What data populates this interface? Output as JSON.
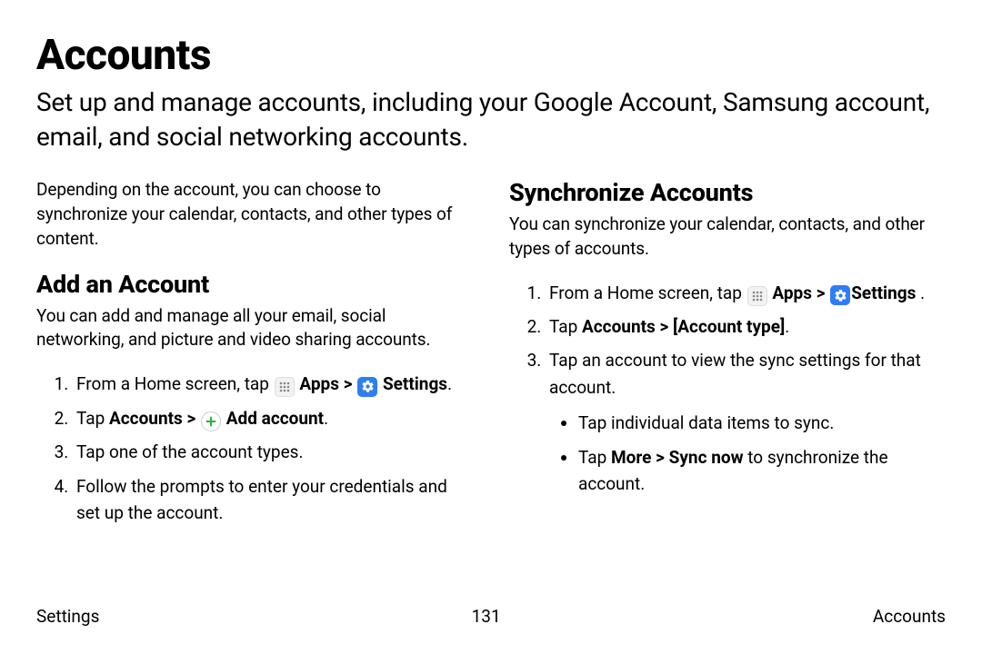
{
  "page": {
    "title": "Accounts",
    "intro": "Set up and manage accounts, including your Google Account, Samsung account, email, and social networking accounts."
  },
  "left": {
    "preface": "Depending on the account, you can choose to synchronize your calendar, contacts, and other types of content.",
    "heading": "Add an Account",
    "desc": "You can add and manage all your email, social networking, and picture and video sharing accounts.",
    "step1_pre": "From a Home screen, tap ",
    "apps_label": "Apps",
    "chev": ">",
    "settings_label": "Settings",
    "step1_post": ".",
    "step2_pre": "Tap ",
    "step2_accounts": "Accounts",
    "step2_chev": " > ",
    "step2_addaccount": "Add account",
    "step2_post": ".",
    "step3": "Tap one of the account types.",
    "step4": "Follow the prompts to enter your credentials and set up the account."
  },
  "right": {
    "heading": "Synchronize Accounts",
    "desc": "You can synchronize your calendar, contacts, and other types of accounts.",
    "step1_pre": "From a Home screen, tap ",
    "apps_label": "Apps",
    "chev": " > ",
    "settings_label": "Settings",
    "step1_post": " .",
    "step2_pre": "Tap ",
    "step2_bold": "Accounts > [Account type]",
    "step2_post": ".",
    "step3": "Tap an account to view the sync settings for that account.",
    "bullet1": "Tap individual data items to sync.",
    "bullet2_pre": "Tap ",
    "bullet2_bold": "More > Sync now",
    "bullet2_post": " to synchronize the account."
  },
  "footer": {
    "left": "Settings",
    "center": "131",
    "right": "Accounts"
  }
}
